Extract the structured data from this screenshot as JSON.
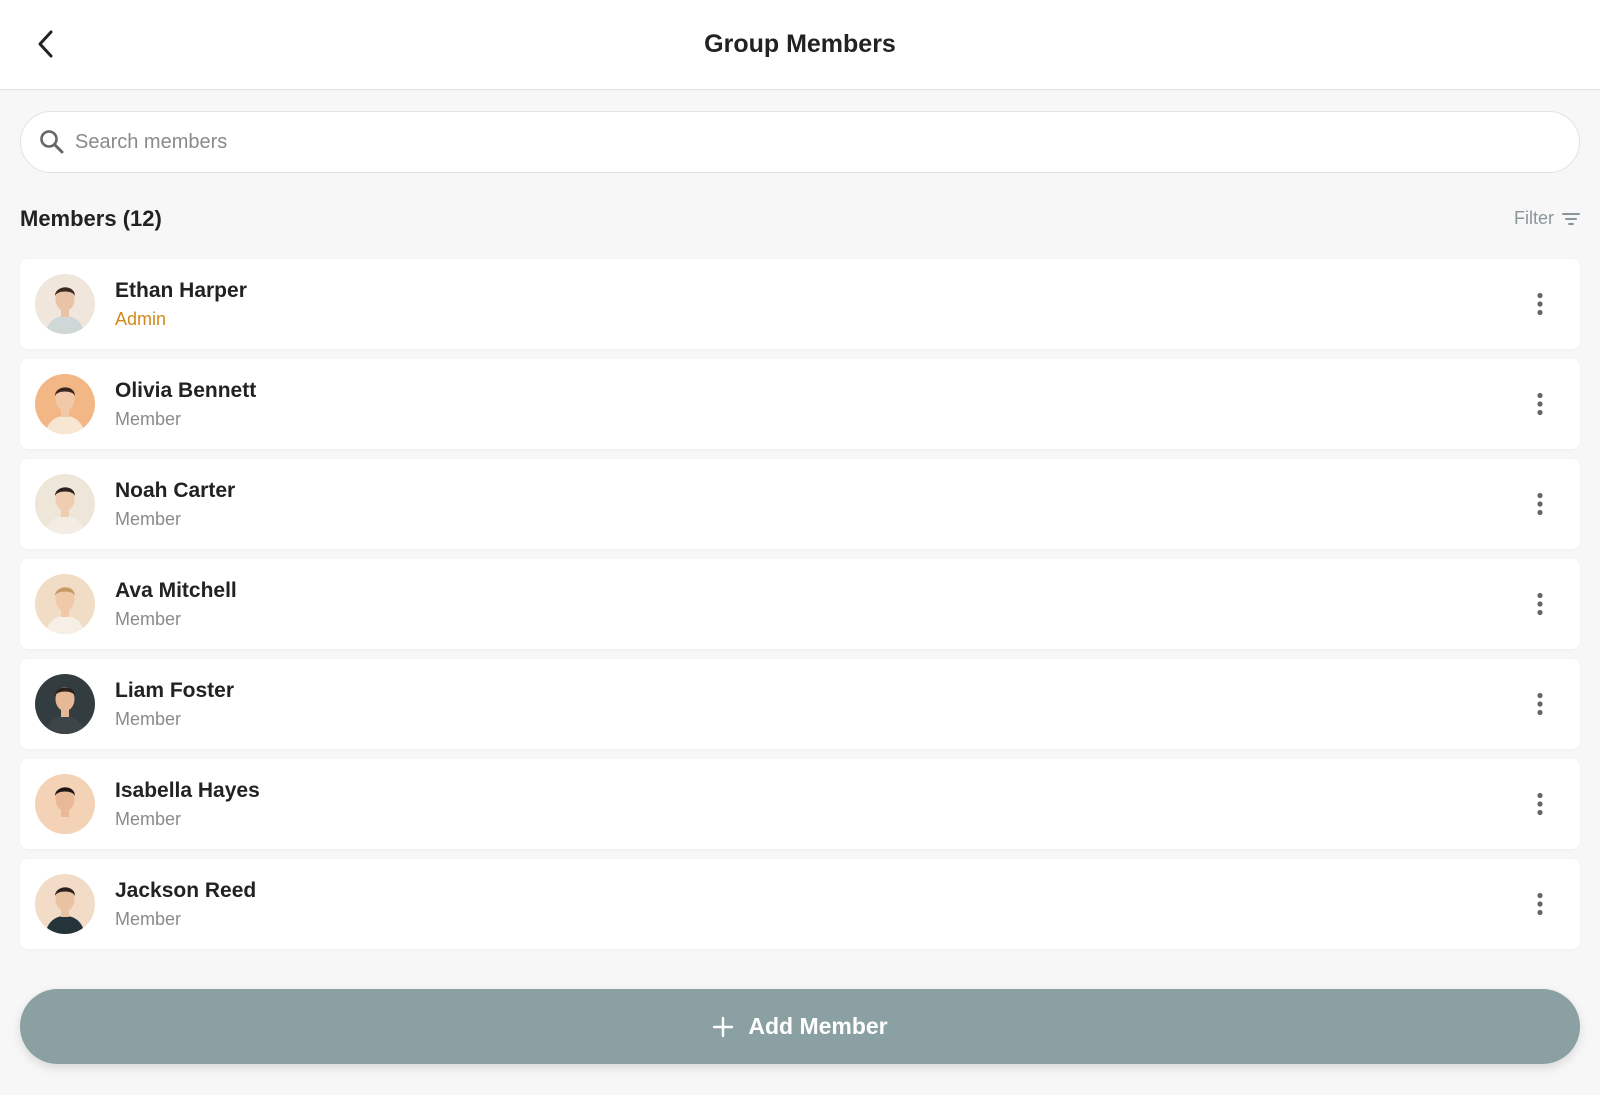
{
  "header": {
    "title": "Group Members",
    "back_icon": "chevron-left-icon"
  },
  "search": {
    "placeholder": "Search members",
    "value": "",
    "icon": "search-icon"
  },
  "members_section": {
    "title": "Members (12)",
    "filter_label": "Filter",
    "filter_icon": "filter-icon"
  },
  "members": [
    {
      "name": "Ethan Harper",
      "role": "Admin",
      "avatar_bg": "#f0e6dc",
      "skin": "#e8c3a6",
      "hair": "#3b2a22",
      "shirt": "#cfd8d6"
    },
    {
      "name": "Olivia Bennett",
      "role": "Member",
      "avatar_bg": "#f2b784",
      "skin": "#f1c8a8",
      "hair": "#3a2620",
      "shirt": "#f7e6d2"
    },
    {
      "name": "Noah Carter",
      "role": "Member",
      "avatar_bg": "#efe6da",
      "skin": "#efcdb1",
      "hair": "#2e2220",
      "shirt": "#f4ede4"
    },
    {
      "name": "Ava Mitchell",
      "role": "Member",
      "avatar_bg": "#f1dcc6",
      "skin": "#f0c9a8",
      "hair": "#c79a64",
      "shirt": "#f6efe6"
    },
    {
      "name": "Liam Foster",
      "role": "Member",
      "avatar_bg": "#333c3e",
      "skin": "#e6b896",
      "hair": "#2b201c",
      "shirt": "#3d4548"
    },
    {
      "name": "Isabella Hayes",
      "role": "Member",
      "avatar_bg": "#f4d2b6",
      "skin": "#e9b897",
      "hair": "#1e1614",
      "shirt": "#f4d2b6"
    },
    {
      "name": "Jackson Reed",
      "role": "Member",
      "avatar_bg": "#f2dcc8",
      "skin": "#e9c2a2",
      "hair": "#2c211d",
      "shirt": "#25343a"
    }
  ],
  "more_icon": "more-vertical-icon",
  "add_member": {
    "label": "Add Member",
    "icon": "plus-icon"
  },
  "colors": {
    "admin_role": "#d08a1a",
    "member_role": "#8a8a8a",
    "add_button": "#8aa0a2",
    "background": "#f7f7f7"
  }
}
